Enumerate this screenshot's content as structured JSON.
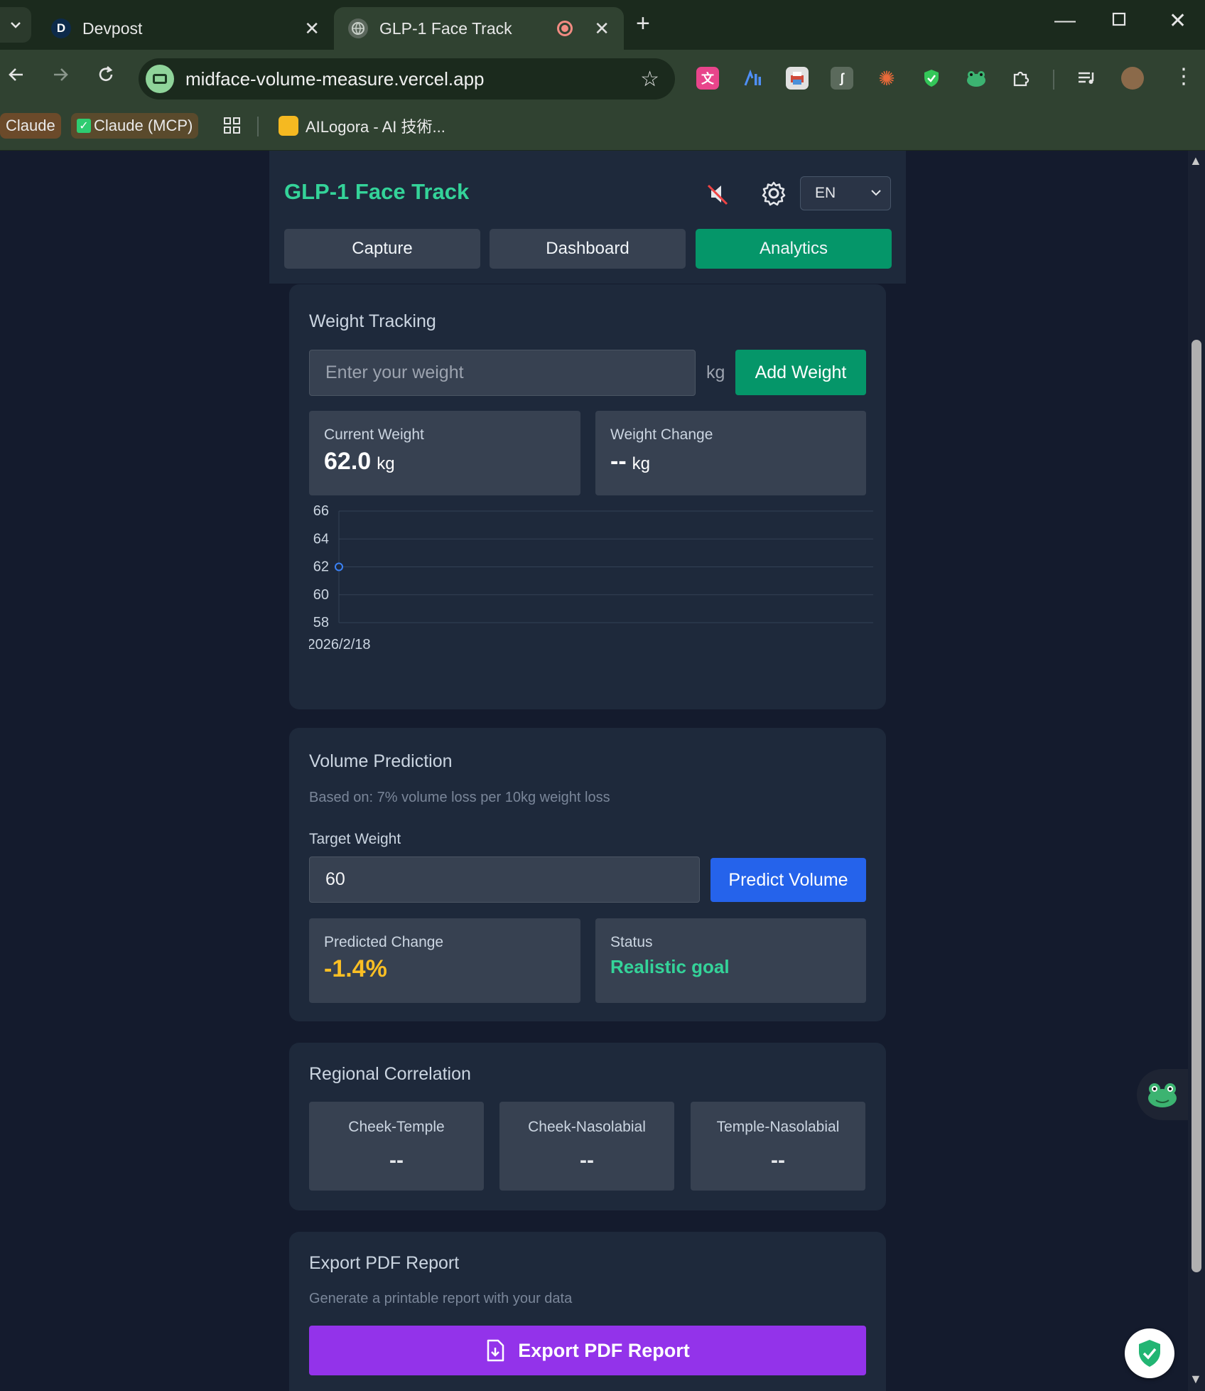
{
  "browser": {
    "tabs": [
      {
        "favicon": "D",
        "title": "Devpost",
        "active": false
      },
      {
        "favicon": "globe-icon",
        "title": "GLP-1 Face Track",
        "active": true
      }
    ],
    "url": "midface-volume-measure.vercel.app",
    "bookmarks": [
      {
        "label": "Claude"
      },
      {
        "label": "Claude (MCP)"
      },
      {
        "label": "AILogora - AI 技術..."
      }
    ]
  },
  "app": {
    "brand": "GLP-1 Face Track",
    "language": "EN",
    "nav": [
      "Capture",
      "Dashboard",
      "Analytics"
    ],
    "active_nav": "Analytics"
  },
  "weight": {
    "title": "Weight Tracking",
    "placeholder": "Enter your weight",
    "unit": "kg",
    "add_button": "Add Weight",
    "current_label": "Current Weight",
    "current_value": "62.0",
    "current_unit": "kg",
    "change_label": "Weight Change",
    "change_value": "--",
    "change_unit": "kg"
  },
  "chart_data": {
    "type": "line",
    "x": [
      "2026/2/18"
    ],
    "series": [
      {
        "values": [
          62
        ]
      }
    ],
    "y_ticks": [
      66,
      64,
      62,
      60,
      58
    ],
    "ylim": [
      58,
      66
    ],
    "grid": true,
    "color": "#3b82f6"
  },
  "prediction": {
    "title": "Volume Prediction",
    "note": "Based on: 7% volume loss per 10kg weight loss",
    "target_label": "Target Weight",
    "target_value": "60",
    "predict_button": "Predict Volume",
    "change_label": "Predicted Change",
    "change_value": "-1.4%",
    "status_label": "Status",
    "status_value": "Realistic goal"
  },
  "correlation": {
    "title": "Regional Correlation",
    "items": [
      {
        "label": "Cheek-Temple",
        "value": "--"
      },
      {
        "label": "Cheek-Nasolabial",
        "value": "--"
      },
      {
        "label": "Temple-Nasolabial",
        "value": "--"
      }
    ]
  },
  "export": {
    "title": "Export PDF Report",
    "note": "Generate a printable report with your data",
    "button": "Export PDF Report"
  },
  "colors": {
    "accent_green": "#059669",
    "brand_green": "#34d399",
    "blue": "#2563eb",
    "purple": "#9333ea",
    "orange": "#fbbf24"
  }
}
